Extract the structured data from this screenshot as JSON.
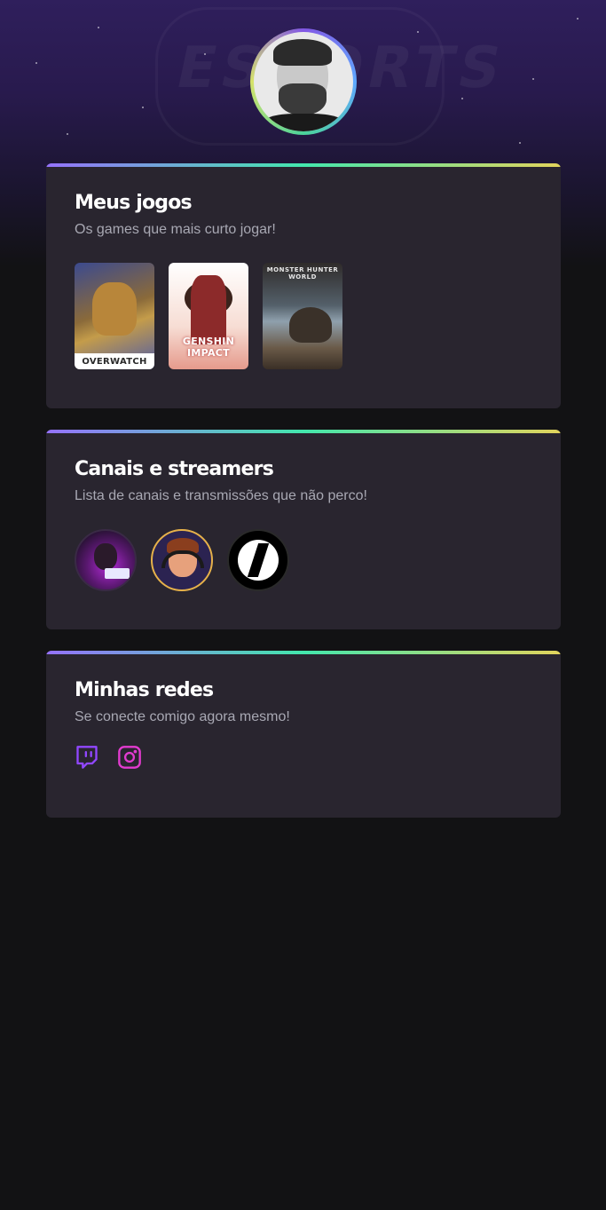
{
  "profile": {
    "avatar_alt": "profile-photo"
  },
  "games_card": {
    "title": "Meus jogos",
    "subtitle": "Os games que mais curto jogar!",
    "games": [
      {
        "caption": "OVERWATCH"
      },
      {
        "caption": "GENSHIN IMPACT"
      },
      {
        "caption": "MONSTER HUNTER WORLD"
      }
    ]
  },
  "channels_card": {
    "title": "Canais e streamers",
    "subtitle": "Lista de canais e transmissões que não perco!"
  },
  "social_card": {
    "title": "Minhas redes",
    "subtitle": "Se conecte comigo agora mesmo!",
    "icons": [
      "twitch-icon",
      "instagram-icon"
    ]
  },
  "colors": {
    "background": "#121214",
    "card": "#29252f",
    "accent_gradient": [
      "#9572fc",
      "#43e7ad",
      "#e2d45c"
    ],
    "twitch": "#9147ff",
    "instagram": "#e33bd0"
  }
}
